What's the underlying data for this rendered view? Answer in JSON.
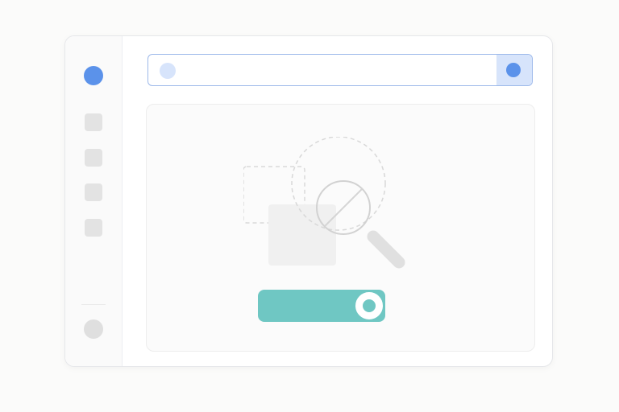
{
  "colors": {
    "accent_blue": "#5b92ea",
    "accent_blue_light": "#d7e4fb",
    "teal": "#6fc7c3",
    "gray_placeholder": "#e3e3e3"
  },
  "sidebar": {
    "top_icon": "app-dot-icon",
    "items": [
      {
        "icon": "nav-square-icon"
      },
      {
        "icon": "nav-square-icon"
      },
      {
        "icon": "nav-square-icon"
      },
      {
        "icon": "nav-square-icon"
      }
    ],
    "bottom_icon": "user-avatar-icon"
  },
  "search": {
    "value": "",
    "placeholder": "",
    "left_icon": "search-dot-icon",
    "submit_icon": "search-submit-icon"
  },
  "empty_state": {
    "illustration_icons": [
      "placeholder-square-icon",
      "magnifier-icon",
      "no-results-icon"
    ]
  },
  "cta": {
    "label": "",
    "icon": "toggle-knob-icon"
  }
}
